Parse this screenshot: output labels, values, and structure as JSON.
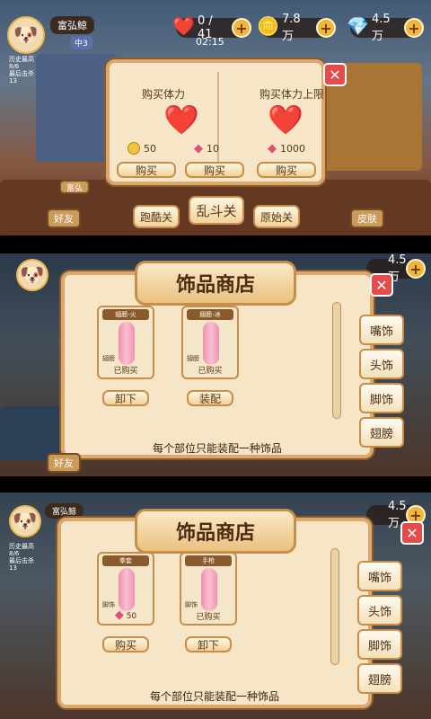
{
  "screen1": {
    "player": {
      "name": "富弘鲸",
      "level": "中3",
      "stats": [
        "历史最高",
        "8/6",
        "最后击杀",
        "13"
      ]
    },
    "resources": [
      {
        "icon": "heart-icon",
        "value": "0 / 41"
      },
      {
        "icon": "coin-icon",
        "value": "7.8万"
      },
      {
        "icon": "gem-icon",
        "value": "4.5万"
      }
    ],
    "timer": "02:15",
    "side_buttons": [
      "好友",
      "跑酷关",
      "乱斗关",
      "原始关",
      "皮肤",
      "富弘"
    ],
    "modal": {
      "left": {
        "title": "购买体力",
        "price1": "50",
        "price2": "10",
        "buy1": "购买",
        "buy2": "购买"
      },
      "right": {
        "title": "购买体力上限",
        "price": "1000",
        "buy": "购买"
      }
    }
  },
  "screen2": {
    "resources": [
      {
        "value": "4.5万"
      }
    ],
    "title": "饰品商店",
    "tabs": [
      "嘴饰",
      "头饰",
      "脚饰",
      "翅膀"
    ],
    "items": [
      {
        "name": "翅膀-火",
        "slot": "翅膀",
        "status": "已购买",
        "action": "卸下"
      },
      {
        "name": "翅膀-冰",
        "slot": "翅膀",
        "status": "已购买",
        "action": "装配"
      }
    ],
    "hint": "每个部位只能装配一种饰品",
    "friend": "好友"
  },
  "screen3": {
    "player": {
      "name": "富弘鲸",
      "stats": [
        "历史最高",
        "8/6",
        "最后击杀",
        "13"
      ]
    },
    "resources": [
      {
        "value": "4.5万"
      }
    ],
    "title": "饰品商店",
    "tabs": [
      "嘴饰",
      "头饰",
      "脚饰",
      "翅膀"
    ],
    "items": [
      {
        "name": "拳套",
        "slot": "脚饰",
        "price": "50",
        "action": "购买"
      },
      {
        "name": "手枪",
        "slot": "脚饰",
        "status": "已购买",
        "action": "卸下"
      }
    ],
    "hint": "每个部位只能装配一种饰品"
  }
}
